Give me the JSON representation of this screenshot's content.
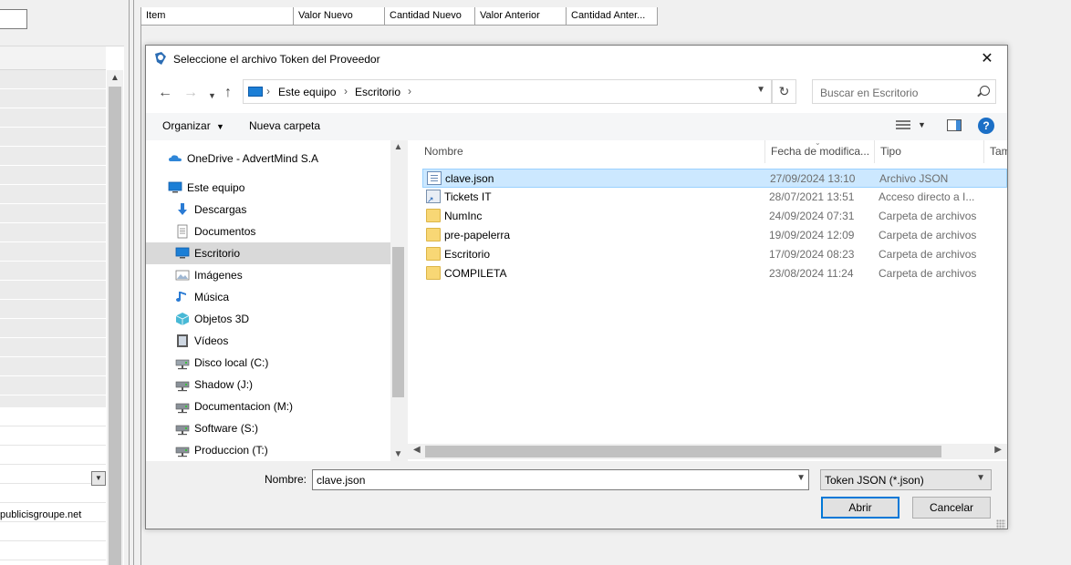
{
  "background": {
    "grid_headers": [
      "Item",
      "Valor Nuevo",
      "Cantidad Nuevo",
      "Valor Anterior",
      "Cantidad Anter..."
    ],
    "email_partial": "publicisgroupe.net"
  },
  "dialog": {
    "title": "Seleccione el archivo Token del Proveedor",
    "address": [
      "Este equipo",
      "Escritorio"
    ],
    "search_placeholder": "Buscar en Escritorio",
    "toolbar": {
      "organize": "Organizar",
      "new_folder": "Nueva carpeta"
    },
    "nav": [
      {
        "label": "OneDrive - AdvertMind S.A",
        "icon": "onedrive-icon"
      },
      {
        "label": "Este equipo",
        "icon": "computer-icon"
      },
      {
        "label": "Descargas",
        "icon": "downloads-icon"
      },
      {
        "label": "Documentos",
        "icon": "documents-icon"
      },
      {
        "label": "Escritorio",
        "icon": "desktop-icon"
      },
      {
        "label": "Imágenes",
        "icon": "pictures-icon"
      },
      {
        "label": "Música",
        "icon": "music-icon"
      },
      {
        "label": "Objetos 3D",
        "icon": "3d-objects-icon"
      },
      {
        "label": "Vídeos",
        "icon": "videos-icon"
      },
      {
        "label": "Disco local (C:)",
        "icon": "local-disk-icon"
      },
      {
        "label": "Shadow (J:)",
        "icon": "network-drive-icon"
      },
      {
        "label": "Documentacion (M:)",
        "icon": "network-drive-icon"
      },
      {
        "label": "Software (S:)",
        "icon": "network-drive-icon"
      },
      {
        "label": "Produccion (T:)",
        "icon": "network-drive-icon"
      }
    ],
    "columns": [
      "Nombre",
      "Fecha de modifica...",
      "Tipo",
      "Tam"
    ],
    "files": [
      {
        "name": "clave.json",
        "date": "27/09/2024 13:10",
        "type": "Archivo JSON",
        "icon": "json-file-icon"
      },
      {
        "name": "Tickets IT",
        "date": "28/07/2021 13:51",
        "type": "Acceso directo a I...",
        "icon": "shortcut-icon"
      },
      {
        "name": "NumInc",
        "date": "24/09/2024 07:31",
        "type": "Carpeta de archivos",
        "icon": "folder-icon"
      },
      {
        "name": "pre-papelerra",
        "date": "19/09/2024 12:09",
        "type": "Carpeta de archivos",
        "icon": "folder-icon"
      },
      {
        "name": "Escritorio",
        "date": "17/09/2024 08:23",
        "type": "Carpeta de archivos",
        "icon": "folder-icon"
      },
      {
        "name": "COMPILETA",
        "date": "23/08/2024 11:24",
        "type": "Carpeta de archivos",
        "icon": "folder-icon"
      }
    ],
    "filename_label": "Nombre:",
    "filename_value": "clave.json",
    "filetype": "Token JSON (*.json)",
    "open_label": "Abrir",
    "cancel_label": "Cancelar",
    "colors": {
      "selection": "#cce8ff",
      "accent": "#0078d7",
      "folder": "#f8d775"
    }
  }
}
